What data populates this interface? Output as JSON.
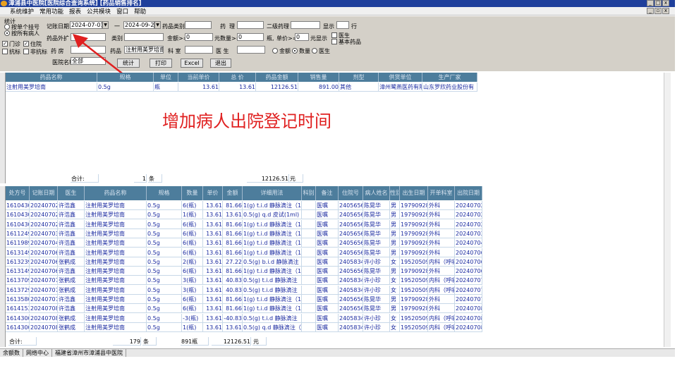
{
  "title": "漳浦县中医院[医院综合查询系统] [药品销售排名]",
  "menu": [
    "系统维护",
    "常用功能",
    "报表",
    "公共模块",
    "窗口",
    "帮助"
  ],
  "form": {
    "group_label": "统计",
    "radio_single": "按单个挂号",
    "radio_all": "按所有病人",
    "date_label": "记账日期",
    "date_from": "2024-07-01",
    "dash": "一",
    "date_to": "2024-09-23",
    "drug_category": "药品类别",
    "drug_name_lbl": "药",
    "drug_name_lbl2": "理",
    "second_pharm": "二级药理",
    "display": "显示",
    "row": "行",
    "drug_ext": "药品外扩",
    "category": "类别",
    "amount_ge": "金额>=",
    "amount_val": "0",
    "qty_label": "元数量>=",
    "qty_val": "0",
    "bottle_label": "瓶,",
    "price_label": "单价>=",
    "price_val": "0",
    "price_display": "元显示",
    "doctor_chk": "医生",
    "basic_drug": "基本药品",
    "outpatient": "门诊",
    "inpatient": "住院",
    "antibiotic": "抗标",
    "non_antibiotic": "非抗标",
    "pharmacy": "药 房",
    "drug_lbl": "药品",
    "drug_val": "注射用美罗培南",
    "dept": "科 室",
    "doctor": "医 生",
    "opt_amount": "金额",
    "opt_qty": "数量",
    "opt_doctor": "医生",
    "hospital_lbl": "医院名称",
    "hospital_val": "全部",
    "btn_stat": "统计",
    "btn_print": "打印",
    "btn_excel": "Excel",
    "btn_exit": "退出"
  },
  "top_grid": {
    "headers": [
      "药品名称",
      "规格",
      "单位",
      "当前单价",
      "总 价",
      "药品金额",
      "销售量",
      "剂型",
      "供货单位",
      "生产厂家"
    ],
    "rows": [
      [
        "注射用美罗培南",
        "0.5g",
        "瓶",
        "13.61",
        "13.61",
        "12126.51",
        "891.00",
        "其他",
        "漳州鹭燕医药有限",
        "山东罗欣药业股份有"
      ]
    ],
    "total": [
      "合计:",
      "1",
      "条",
      "12126.51",
      "元"
    ]
  },
  "bottom_grid": {
    "headers": [
      "处方号",
      "记账日期",
      "医生",
      "药品名称",
      "规格",
      "数量",
      "单价",
      "金额",
      "详细用法",
      "科别",
      "备注",
      "住院号",
      "病人姓名",
      "性别",
      "出生日期",
      "开单科室",
      "出院日期"
    ],
    "rows": [
      [
        "1610430",
        "20240702",
        "许浩鑫",
        "注射用美罗培南",
        "0.5g",
        "6(瓶)",
        "13.61",
        "81.66",
        "1(g) t.i.d 静脉滴注（10",
        "",
        "医嘱",
        "2405656",
        "陈晃华",
        "男",
        "19790928",
        "外科",
        "20240702"
      ],
      [
        "1610430",
        "20240702",
        "许浩鑫",
        "注射用美罗培南",
        "0.5g",
        "1(瓶)",
        "13.61",
        "13.61",
        "0.5(g) q.d 皮试(1ml)",
        "",
        "医嘱",
        "2405656",
        "陈晃华",
        "男",
        "19790928",
        "外科",
        "20240702"
      ],
      [
        "1610430",
        "20240702",
        "许浩鑫",
        "注射用美罗培南",
        "0.5g",
        "6(瓶)",
        "13.61",
        "81.66",
        "1(g) t.i.d 静脉滴注（10",
        "",
        "医嘱",
        "2405656",
        "陈晃华",
        "男",
        "19790928",
        "外科",
        "20240702"
      ],
      [
        "1611249",
        "20240703",
        "许浩鑫",
        "注射用美罗培南",
        "0.5g",
        "6(瓶)",
        "13.61",
        "81.66",
        "1(g) t.i.d 静脉滴注（10",
        "",
        "医嘱",
        "2405656",
        "陈晃华",
        "男",
        "19790928",
        "外科",
        "20240703"
      ],
      [
        "1611989",
        "20240704",
        "许浩鑫",
        "注射用美罗培南",
        "0.5g",
        "6(瓶)",
        "13.61",
        "81.66",
        "1(g) t.i.d 静脉滴注（10",
        "",
        "医嘱",
        "2405656",
        "陈晃华",
        "男",
        "19790928",
        "外科",
        "20240704"
      ],
      [
        "1613149",
        "20240706",
        "许浩鑫",
        "注射用美罗培南",
        "0.5g",
        "6(瓶)",
        "13.61",
        "81.66",
        "1(g) t.i.d 静脉滴注（10",
        "",
        "医嘱",
        "2405656",
        "陈晃华",
        "男",
        "19790928",
        "外科",
        "20240706"
      ],
      [
        "1613239",
        "20240706",
        "张鹤成",
        "注射用美罗培南",
        "0.5g",
        "2(瓶)",
        "13.61",
        "27.22",
        "0.5(g) b.i.d 静脉滴注（",
        "",
        "医嘱",
        "2405834",
        "许小珍",
        "女",
        "19520509",
        "内科（呼吸",
        "20240706"
      ],
      [
        "1613149",
        "20240706",
        "许浩鑫",
        "注射用美罗培南",
        "0.5g",
        "6(瓶)",
        "13.61",
        "81.66",
        "1(g) t.i.d 静脉滴注（10",
        "",
        "医嘱",
        "2405656",
        "陈晃华",
        "男",
        "19790928",
        "外科",
        "20240706"
      ],
      [
        "1613709",
        "20240707",
        "张鹤成",
        "注射用美罗培南",
        "0.5g",
        "3(瓶)",
        "13.61",
        "40.83",
        "0.5(g) t.i.d 静脉滴注（2",
        "",
        "医嘱",
        "2405834",
        "许小珍",
        "女",
        "19520509",
        "内科（呼吸",
        "20240707"
      ],
      [
        "1613729",
        "20240707",
        "张鹤成",
        "注射用美罗培南",
        "0.5g",
        "3(瓶)",
        "13.61",
        "40.83",
        "0.5(g) t.i.d 静脉滴注（2",
        "",
        "医嘱",
        "2405834",
        "许小珍",
        "女",
        "19520509",
        "内科（呼吸",
        "20240707"
      ],
      [
        "1613580",
        "20240707",
        "许浩鑫",
        "注射用美罗培南",
        "0.5g",
        "6(瓶)",
        "13.61",
        "81.66",
        "1(g) t.i.d 静脉滴注（10",
        "",
        "医嘱",
        "2405656",
        "陈晃华",
        "男",
        "19790928",
        "外科",
        "20240707"
      ],
      [
        "1614153",
        "20240708",
        "许浩鑫",
        "注射用美罗培南",
        "0.5g",
        "6(瓶)",
        "13.61",
        "81.66",
        "1(g) t.i.d 静脉滴注（10",
        "",
        "医嘱",
        "2405656",
        "陈晃华",
        "男",
        "19790928",
        "外科",
        "20240708"
      ],
      [
        "1614300",
        "20240708",
        "张鹤成",
        "注射用美罗培南",
        "0.5g",
        "-3(瓶)",
        "13.61",
        "-40.83",
        "0.5(g) t.i.d 静脉滴注（2",
        "",
        "医嘱",
        "2405834",
        "许小珍",
        "女",
        "19520509",
        "内科（呼吸",
        "20240708"
      ],
      [
        "1614300",
        "20240708",
        "张鹤成",
        "注射用美罗培南",
        "0.5g",
        "1(瓶)",
        "13.61",
        "13.61",
        "0.5(g) q.d 静脉滴注（2",
        "",
        "医嘱",
        "2405834",
        "许小珍",
        "女",
        "19520509",
        "内科（呼吸",
        "20240708"
      ]
    ],
    "total": [
      "合计:",
      "179",
      "条",
      "891瓶",
      "12126.51",
      "元"
    ]
  },
  "status": [
    "余额数",
    "网络中心",
    "福建省漳州市漳浦县中医院"
  ],
  "annotation": "增加病人出院登记时间",
  "colors": {
    "title": "#1f3f9b",
    "header": "#4d7d9c",
    "annotation": "#e02020"
  }
}
